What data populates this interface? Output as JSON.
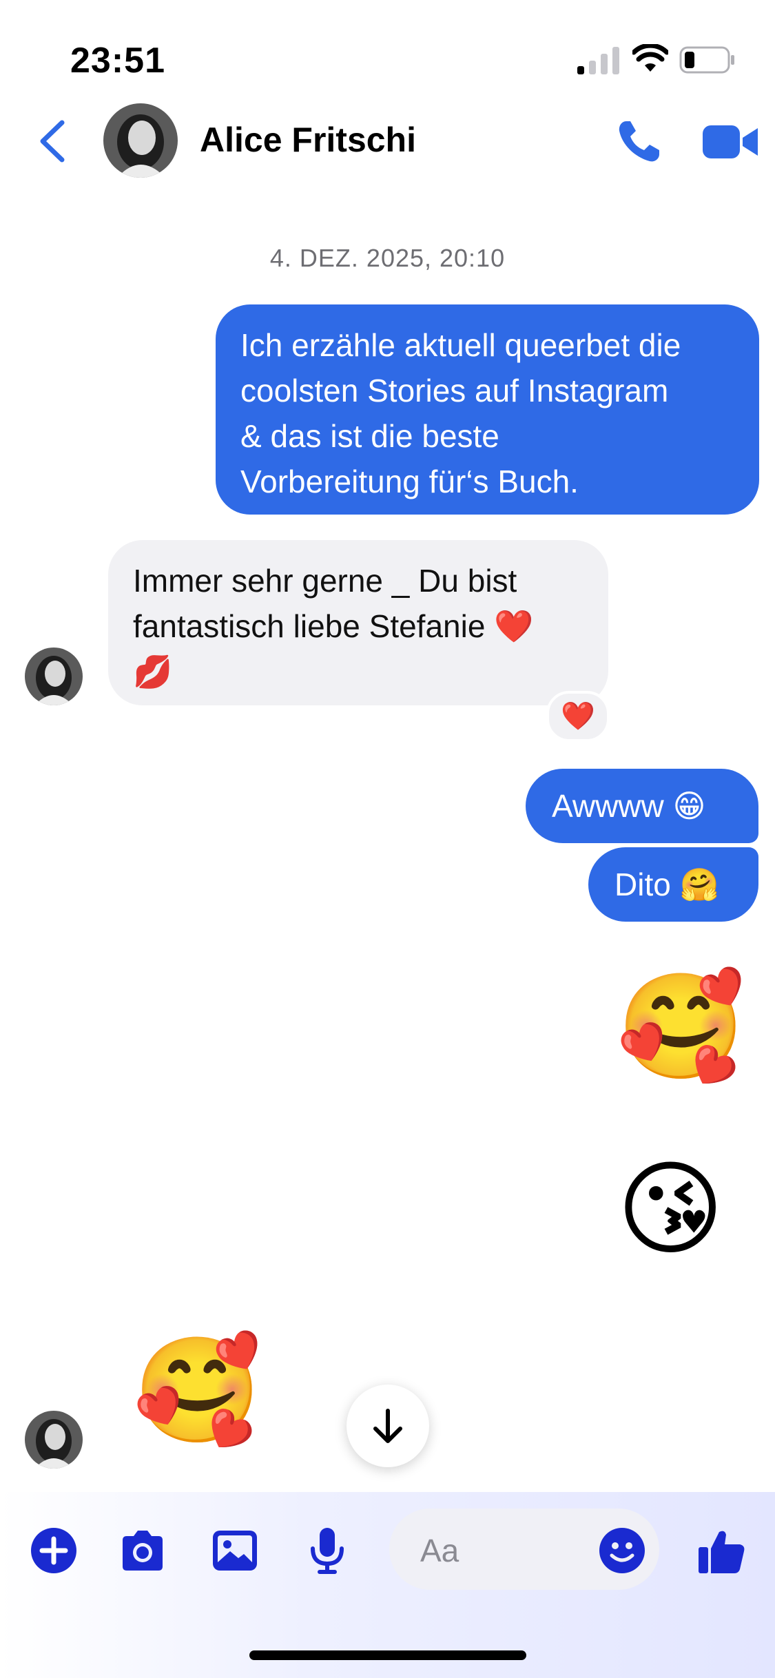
{
  "status_bar": {
    "time": "23:51",
    "signal_bars": 1,
    "battery_level": 0.2
  },
  "header": {
    "contact_name": "Alice Fritschi",
    "icons": [
      "back-chevron-icon",
      "avatar",
      "phone-icon",
      "video-camera-icon"
    ],
    "accent_color": "#2f6ae6"
  },
  "conversation": {
    "timestamp": "4. DEZ. 2025, 20:10",
    "messages": [
      {
        "direction": "out",
        "lines": [
          "Ich erzähle aktuell queerbet die",
          "coolsten Stories auf Instagram",
          "& das ist die beste",
          "Vorbereitung für‘s Buch."
        ]
      },
      {
        "direction": "in",
        "lines": [
          "Immer sehr gerne _ Du bist",
          "fantastisch liebe Stefanie ❤️",
          "💋"
        ],
        "reaction": "❤️"
      },
      {
        "direction": "out",
        "text": "Awwww 😁"
      },
      {
        "direction": "out",
        "text": "Dito 🤗"
      },
      {
        "direction": "out",
        "emoji": "🥰"
      },
      {
        "direction": "out",
        "emoji": "😘"
      },
      {
        "direction": "in",
        "emoji": "🥰"
      }
    ]
  },
  "composer": {
    "placeholder": "Aa",
    "icons": [
      "plus-circle-icon",
      "camera-icon",
      "photo-icon",
      "microphone-icon",
      "emoji-icon",
      "thumbs-up-icon"
    ],
    "icon_color": "#1a2ad0"
  }
}
